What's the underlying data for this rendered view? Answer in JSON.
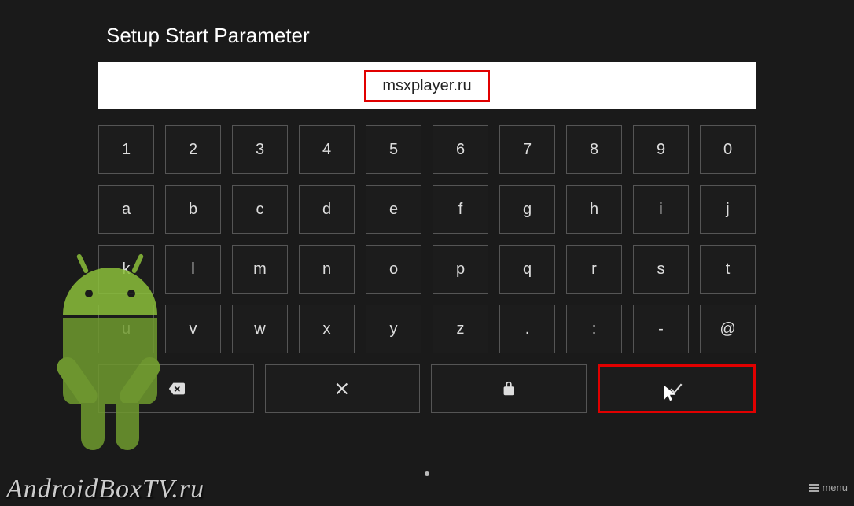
{
  "title": "Setup Start Parameter",
  "input_value": "msxplayer.ru",
  "keyboard": {
    "row1": [
      "1",
      "2",
      "3",
      "4",
      "5",
      "6",
      "7",
      "8",
      "9",
      "0"
    ],
    "row2": [
      "a",
      "b",
      "c",
      "d",
      "e",
      "f",
      "g",
      "h",
      "i",
      "j"
    ],
    "row3": [
      "k",
      "l",
      "m",
      "n",
      "o",
      "p",
      "q",
      "r",
      "s",
      "t"
    ],
    "row4": [
      "u",
      "v",
      "w",
      "x",
      "y",
      "z",
      ".",
      ":",
      "-",
      "@"
    ],
    "actions": {
      "backspace": "backspace-icon",
      "clear": "close-icon",
      "secure": "lock-icon",
      "confirm": "check-icon"
    }
  },
  "watermark": "AndroidBoxTV.ru",
  "menu_label": "menu",
  "colors": {
    "highlight": "#e10000",
    "bg": "#1a1a1a",
    "key_border": "#555555",
    "android_green": "#8bbf3a"
  }
}
